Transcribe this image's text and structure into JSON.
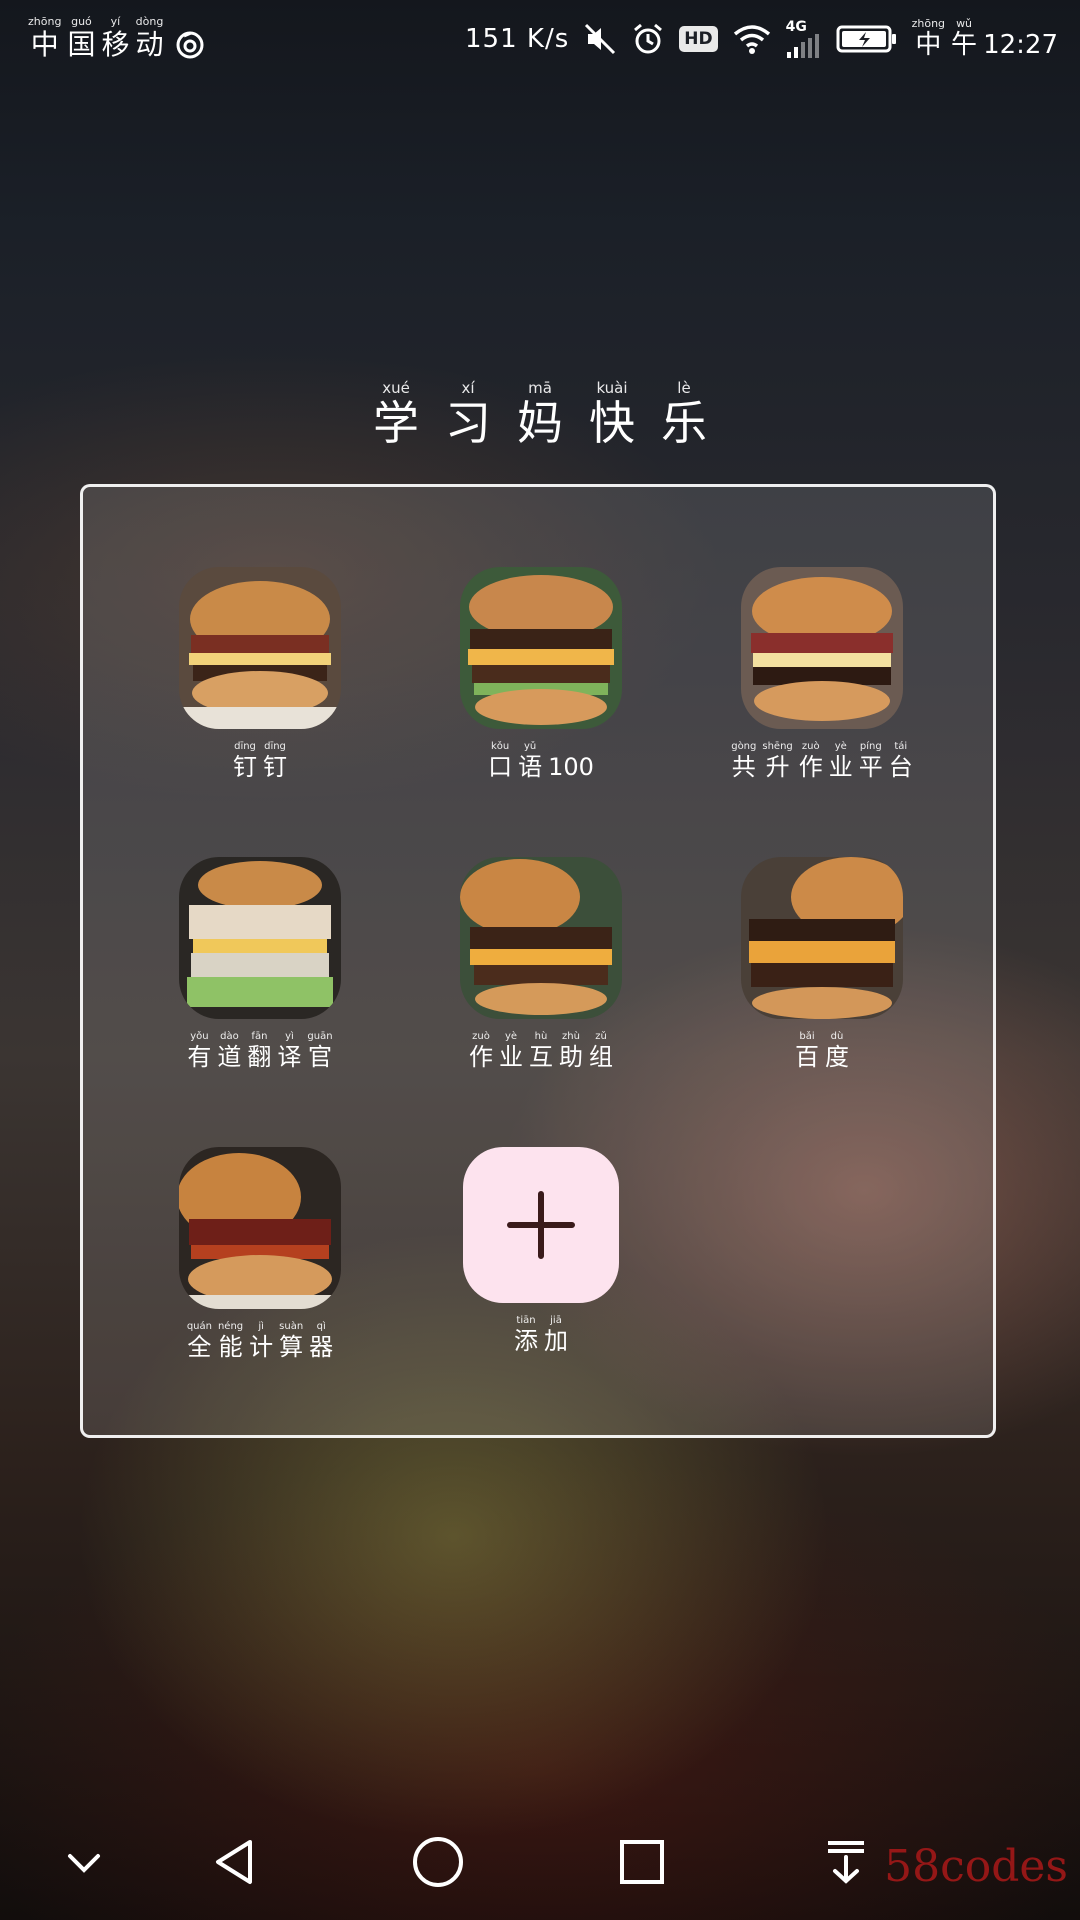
{
  "status_bar": {
    "carrier": [
      {
        "ruby": "zhōng",
        "char": "中"
      },
      {
        "ruby": "guó",
        "char": "国"
      },
      {
        "ruby": "yí",
        "char": "移"
      },
      {
        "ruby": "dòng",
        "char": "动"
      }
    ],
    "speed": "151 K/s",
    "network": "4G",
    "hd": "HD",
    "time_prefix": [
      {
        "ruby": "zhōng",
        "char": "中"
      },
      {
        "ruby": "wǔ",
        "char": "午"
      }
    ],
    "time": "12:27"
  },
  "folder": {
    "title": [
      {
        "ruby": "xué",
        "char": "学"
      },
      {
        "ruby": "xí",
        "char": "习"
      },
      {
        "ruby": "mā",
        "char": "妈"
      },
      {
        "ruby": "kuài",
        "char": "快"
      },
      {
        "ruby": "lè",
        "char": "乐"
      }
    ],
    "apps": [
      {
        "label": [
          {
            "ruby": "dīng",
            "char": "钉"
          },
          {
            "ruby": "dīng",
            "char": "钉"
          }
        ]
      },
      {
        "label": [
          {
            "ruby": "kǒu",
            "char": "口"
          },
          {
            "ruby": "yǔ",
            "char": "语"
          },
          {
            "ruby": "",
            "char": "100"
          }
        ]
      },
      {
        "label": [
          {
            "ruby": "gòng",
            "char": "共"
          },
          {
            "ruby": "shēng",
            "char": "升"
          },
          {
            "ruby": "zuò",
            "char": "作"
          },
          {
            "ruby": "yè",
            "char": "业"
          },
          {
            "ruby": "píng",
            "char": "平"
          },
          {
            "ruby": "tái",
            "char": "台"
          }
        ]
      },
      {
        "label": [
          {
            "ruby": "yǒu",
            "char": "有"
          },
          {
            "ruby": "dào",
            "char": "道"
          },
          {
            "ruby": "fān",
            "char": "翻"
          },
          {
            "ruby": "yì",
            "char": "译"
          },
          {
            "ruby": "guān",
            "char": "官"
          }
        ]
      },
      {
        "label": [
          {
            "ruby": "zuò",
            "char": "作"
          },
          {
            "ruby": "yè",
            "char": "业"
          },
          {
            "ruby": "hù",
            "char": "互"
          },
          {
            "ruby": "zhù",
            "char": "助"
          },
          {
            "ruby": "zǔ",
            "char": "组"
          }
        ]
      },
      {
        "label": [
          {
            "ruby": "bǎi",
            "char": "百"
          },
          {
            "ruby": "dù",
            "char": "度"
          }
        ]
      },
      {
        "label": [
          {
            "ruby": "quán",
            "char": "全"
          },
          {
            "ruby": "néng",
            "char": "能"
          },
          {
            "ruby": "jì",
            "char": "计"
          },
          {
            "ruby": "suàn",
            "char": "算"
          },
          {
            "ruby": "qì",
            "char": "器"
          }
        ]
      }
    ],
    "add": {
      "label": [
        {
          "ruby": "tiān",
          "char": "添"
        },
        {
          "ruby": "jiā",
          "char": "加"
        }
      ]
    }
  },
  "watermark": "58codes",
  "colors": {
    "add_bg": "#fde3ee",
    "add_plus": "#3a1a1a",
    "panel_border": "#ffffff",
    "watermark": "#aa1919"
  },
  "icons": [
    "burger-photo-icon",
    "plus-icon",
    "mute-icon",
    "alarm-icon",
    "wifi-icon",
    "signal-icon",
    "battery-icon",
    "weibo-icon",
    "chevron-down-icon",
    "back-triangle-icon",
    "home-circle-icon",
    "recent-square-icon",
    "pull-down-icon"
  ]
}
